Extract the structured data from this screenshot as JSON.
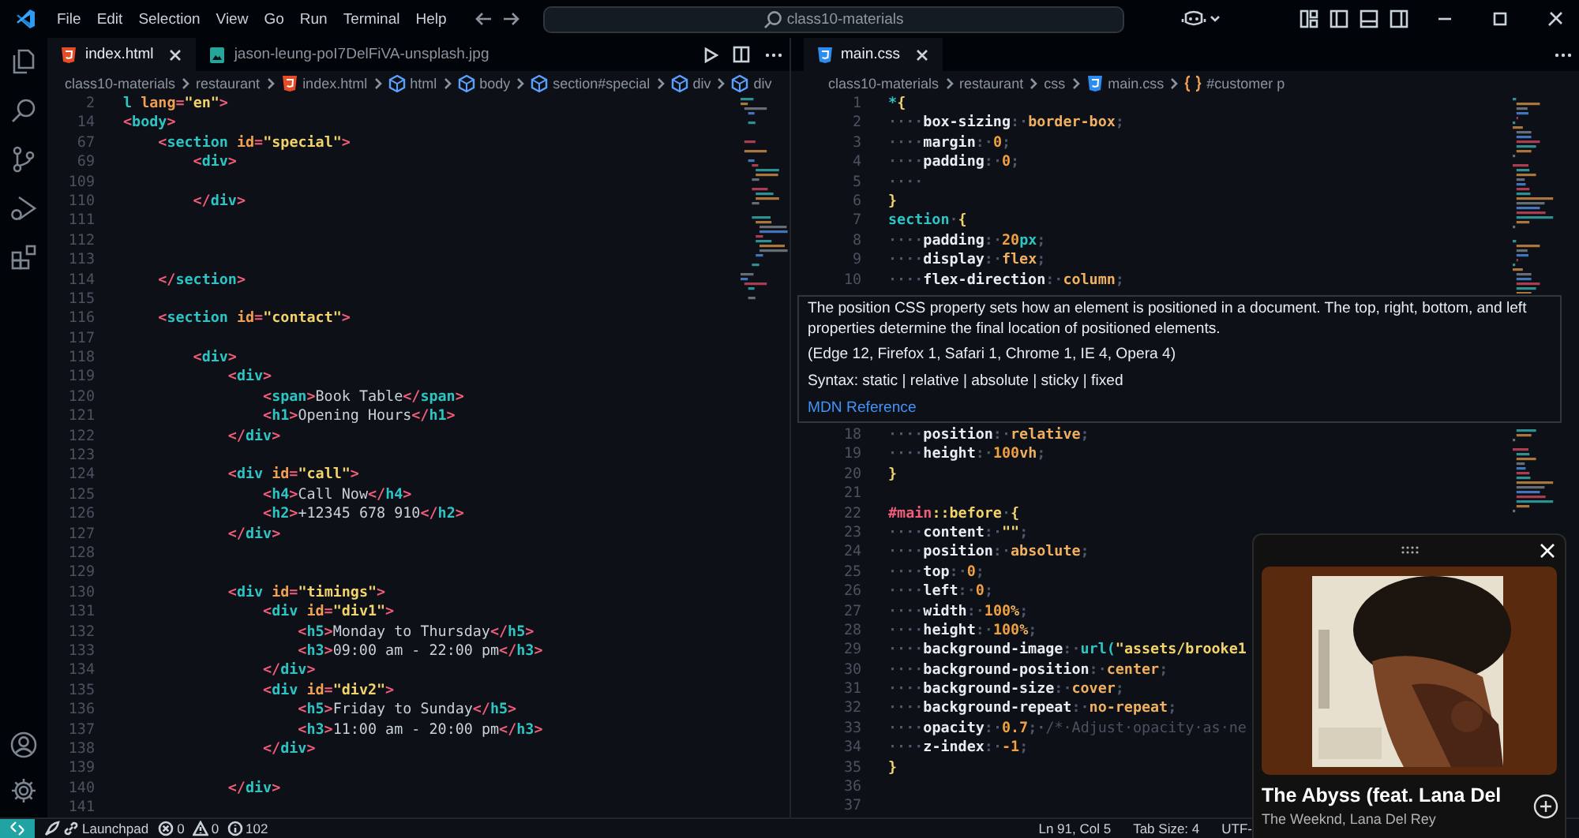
{
  "title_bar": {
    "menu": [
      "File",
      "Edit",
      "Selection",
      "View",
      "Go",
      "Run",
      "Terminal",
      "Help"
    ],
    "search": "class10-materials"
  },
  "left_editor": {
    "tabs": [
      {
        "label": "index.html",
        "kind": "html",
        "selected": true
      },
      {
        "label": "jason-leung-poI7DelFiVA-unsplash.jpg",
        "selected": false
      }
    ],
    "breadcrumbs": [
      {
        "label": "class10-materials",
        "kind": "folder"
      },
      {
        "label": "restaurant",
        "kind": "folder"
      },
      {
        "label": "index.html",
        "kind": "html"
      },
      {
        "label": "html",
        "kind": "element"
      },
      {
        "label": "body",
        "kind": "element"
      },
      {
        "label": "section#special",
        "kind": "element"
      },
      {
        "label": "div",
        "kind": "element"
      },
      {
        "label": "div",
        "kind": "element"
      }
    ],
    "lines": [
      {
        "number": "2",
        "text": "l lang=\"en\">"
      },
      {
        "number": "14",
        "text": "<body>"
      },
      {
        "number": "67",
        "text": "    <section id=\"special\">"
      },
      {
        "number": "69",
        "text": "        <div>"
      },
      {
        "number": "109"
      },
      {
        "number": "110",
        "text": "        </div>"
      },
      {
        "number": "111"
      },
      {
        "number": "112"
      },
      {
        "number": "113"
      },
      {
        "number": "114",
        "text": "    </section>"
      },
      {
        "number": "115"
      },
      {
        "number": "116",
        "text": "    <section id=\"contact\">"
      },
      {
        "number": "117"
      },
      {
        "number": "118",
        "text": "        <div>"
      },
      {
        "number": "119",
        "text": "            <div>"
      },
      {
        "number": "120",
        "text": "                <span>Book Table</span>"
      },
      {
        "number": "121",
        "text": "                <h1>Opening Hours</h1>"
      },
      {
        "number": "122",
        "text": "            </div>"
      },
      {
        "number": "123"
      },
      {
        "number": "124",
        "text": "            <div id=\"call\">"
      },
      {
        "number": "125",
        "text": "                <h4>Call Now</h4>"
      },
      {
        "number": "126",
        "text": "                <h2>+12345 678 910</h2>"
      },
      {
        "number": "127",
        "text": "            </div>"
      },
      {
        "number": "128"
      },
      {
        "number": "129"
      },
      {
        "number": "130",
        "text": "            <div id=\"timings\">"
      },
      {
        "number": "131",
        "text": "                <div id=\"div1\">"
      },
      {
        "number": "132",
        "text": "                    <h5>Monday to Thursday</h5>"
      },
      {
        "number": "133",
        "text": "                    <h3>09:00 am - 22:00 pm</h3>"
      },
      {
        "number": "134",
        "text": "                </div>"
      },
      {
        "number": "135",
        "text": "                <div id=\"div2\">"
      },
      {
        "number": "136",
        "text": "                    <h5>Friday to Sunday</h5>"
      },
      {
        "number": "137",
        "text": "                    <h3>11:00 am - 20:00 pm</h3>"
      },
      {
        "number": "138",
        "text": "                </div>"
      },
      {
        "number": "139"
      },
      {
        "number": "140",
        "text": "            </div>"
      },
      {
        "number": "141"
      }
    ]
  },
  "right_editor": {
    "tabs": [
      {
        "label": "main.css",
        "kind": "css",
        "selected": true
      }
    ],
    "breadcrumbs": [
      {
        "label": "class10-materials",
        "kind": "folder"
      },
      {
        "label": "restaurant",
        "kind": "folder"
      },
      {
        "label": "css",
        "kind": "folder"
      },
      {
        "label": "main.css",
        "kind": "css"
      },
      {
        "label": "#customer p",
        "kind": "selector"
      }
    ],
    "lines_top": [
      {
        "number": "1",
        "text": "*{"
      },
      {
        "number": "2",
        "text": "····box-sizing:·border-box;"
      },
      {
        "number": "3",
        "text": "····margin:·0;"
      },
      {
        "number": "4",
        "text": "····padding:·0;"
      },
      {
        "number": "5",
        "text": "····"
      },
      {
        "number": "6",
        "text": "}"
      },
      {
        "number": "7",
        "text": "section·{"
      },
      {
        "number": "8",
        "text": "····padding:·20px;"
      },
      {
        "number": "9",
        "text": "····display:·flex;"
      },
      {
        "number": "10",
        "text": "····flex-direction:·column;"
      }
    ],
    "hover": {
      "description": "The position CSS property sets how an element is positioned in a document. The top, right, bottom, and left properties determine the final location of positioned elements.",
      "compatibility": "(Edge 12, Firefox 1, Safari 1, Chrome 1, IE 4, Opera 4)",
      "syntax": "Syntax: static | relative | absolute | sticky | fixed",
      "link": "MDN Reference"
    },
    "lines_bottom": [
      {
        "number": "18",
        "text": "····position:·relative;"
      },
      {
        "number": "19",
        "text": "····height:·100vh;"
      },
      {
        "number": "20",
        "text": "}"
      },
      {
        "number": "21"
      },
      {
        "number": "22",
        "text": "#main::before·{"
      },
      {
        "number": "23",
        "text": "····content:·\"\";"
      },
      {
        "number": "24",
        "text": "····position:·absolute;"
      },
      {
        "number": "25",
        "text": "····top:·0;"
      },
      {
        "number": "26",
        "text": "····left:·0;"
      },
      {
        "number": "27",
        "text": "····width:·100%;"
      },
      {
        "number": "28",
        "text": "····height:·100%;"
      },
      {
        "number": "29",
        "text": "····background-image:·url(\"assets/brooke1"
      },
      {
        "number": "30",
        "text": "····background-position:·center;"
      },
      {
        "number": "31",
        "text": "····background-size:·cover;"
      },
      {
        "number": "32",
        "text": "····background-repeat:·no-repeat;"
      },
      {
        "number": "33",
        "text": "····opacity:·0.7;·/*·Adjust·opacity·as·ne"
      },
      {
        "number": "34",
        "text": "····z-index:·-1;"
      },
      {
        "number": "35",
        "text": "}"
      },
      {
        "number": "36"
      },
      {
        "number": "37"
      }
    ]
  },
  "media_player": {
    "title": "The Abyss (feat. Lana Del",
    "artist": "The Weeknd, Lana Del Rey"
  },
  "status_bar": {
    "launchpad": "Launchpad",
    "errors": "0",
    "warnings": "0",
    "infos": "102",
    "items": [
      "Ln 91, Col 5",
      "Tab Size: 4",
      "UTF-"
    ]
  }
}
